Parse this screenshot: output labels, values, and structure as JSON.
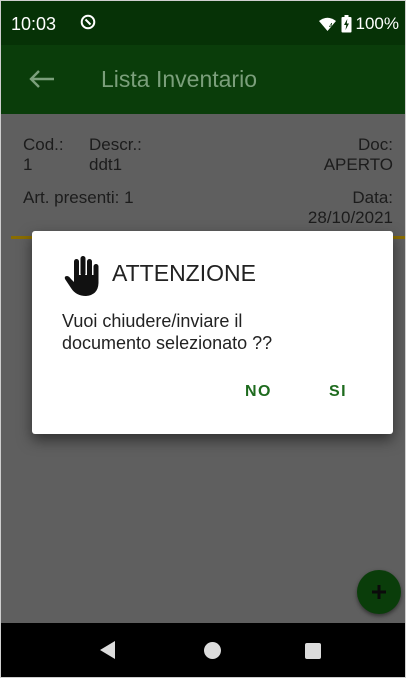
{
  "status_bar": {
    "time": "10:03",
    "battery": "100%",
    "icons": [
      "app-notification-icon",
      "wifi-icon",
      "battery-charging-icon"
    ]
  },
  "app_bar": {
    "title": "Lista Inventario",
    "back_icon": "back-arrow-icon"
  },
  "document": {
    "cod_label": "Cod.:",
    "cod_value": "1",
    "descr_label": "Descr.:",
    "descr_value": "ddt1",
    "doc_label": "Doc:",
    "doc_value": "APERTO",
    "articles_label": "Art. presenti: 1",
    "data_label": "Data:",
    "data_value": "28/10/2021"
  },
  "dialog": {
    "icon": "hand-stop-icon",
    "title": "ATTENZIONE",
    "message": "Vuoi chiudere/inviare il\ndocumento selezionato ??",
    "no_label": "NO",
    "si_label": "SI"
  },
  "fab": {
    "icon": "plus-icon"
  },
  "nav_bar": {
    "icons": [
      "nav-back-icon",
      "nav-home-icon",
      "nav-recents-icon"
    ]
  },
  "colors": {
    "primary_dark": "#063206",
    "primary": "#0a3d0a",
    "accent": "#1e6b1e",
    "divider": "#8a6d00",
    "scrim": "#5f5f5f"
  }
}
